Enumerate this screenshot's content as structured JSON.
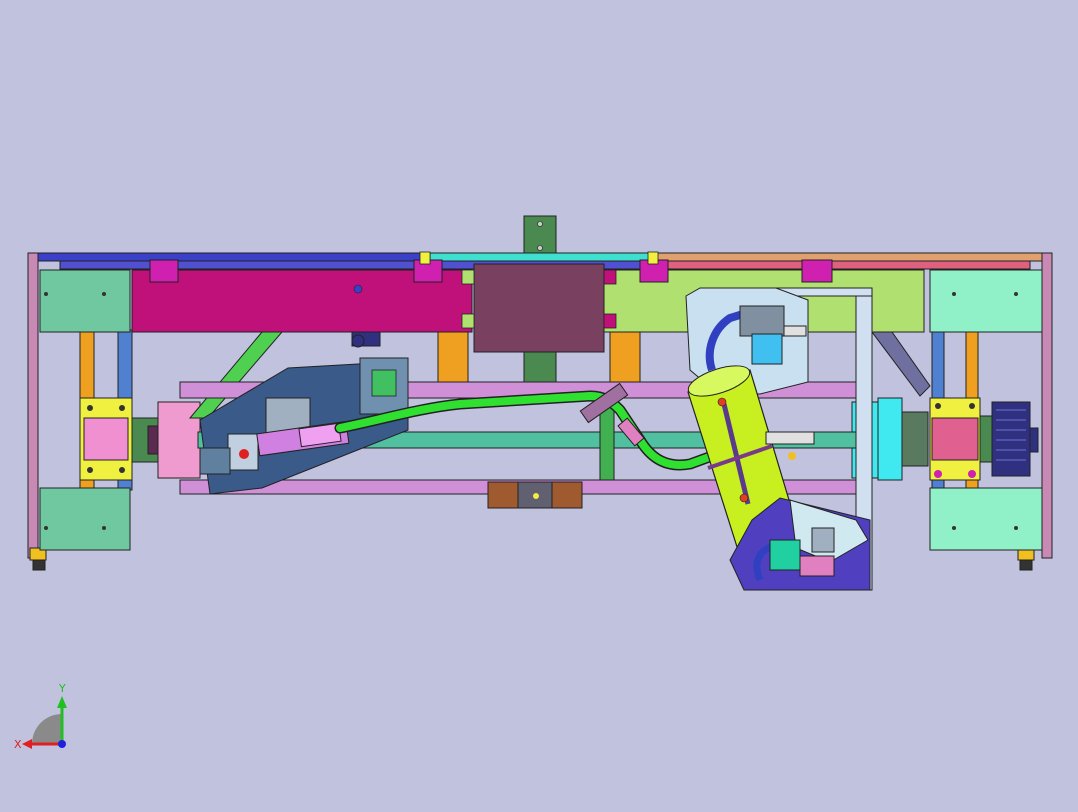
{
  "view": {
    "background": "#c0c2de"
  },
  "triad": {
    "x_label": "X",
    "y_label": "Y",
    "x_color": "#e02020",
    "y_color": "#20c020",
    "z_color": "#2020e0"
  },
  "colors": {
    "frame_outline": "#222222",
    "frame_pink": "#c88ab4",
    "rail_blue": "#3a40c8",
    "rail_cyan": "#40e0d0",
    "beam_magenta": "#c0107a",
    "beam_lime": "#b0e070",
    "plate_mint": "#70c8a0",
    "plate_mint_light": "#90f0c8",
    "block_yellow": "#f0f040",
    "block_pink": "#f090d0",
    "center_maroon": "#7a4060",
    "center_green": "#4a8a50",
    "tube_green": "#30e030",
    "cylinder_lime": "#c8f020",
    "fixture_navy": "#3a5a8a",
    "fixture_purple": "#5040c0",
    "tab_magenta": "#d020b0",
    "column_orange": "#f0a020",
    "motor_blue": "#303080",
    "block_cyan": "#40e8f0"
  }
}
